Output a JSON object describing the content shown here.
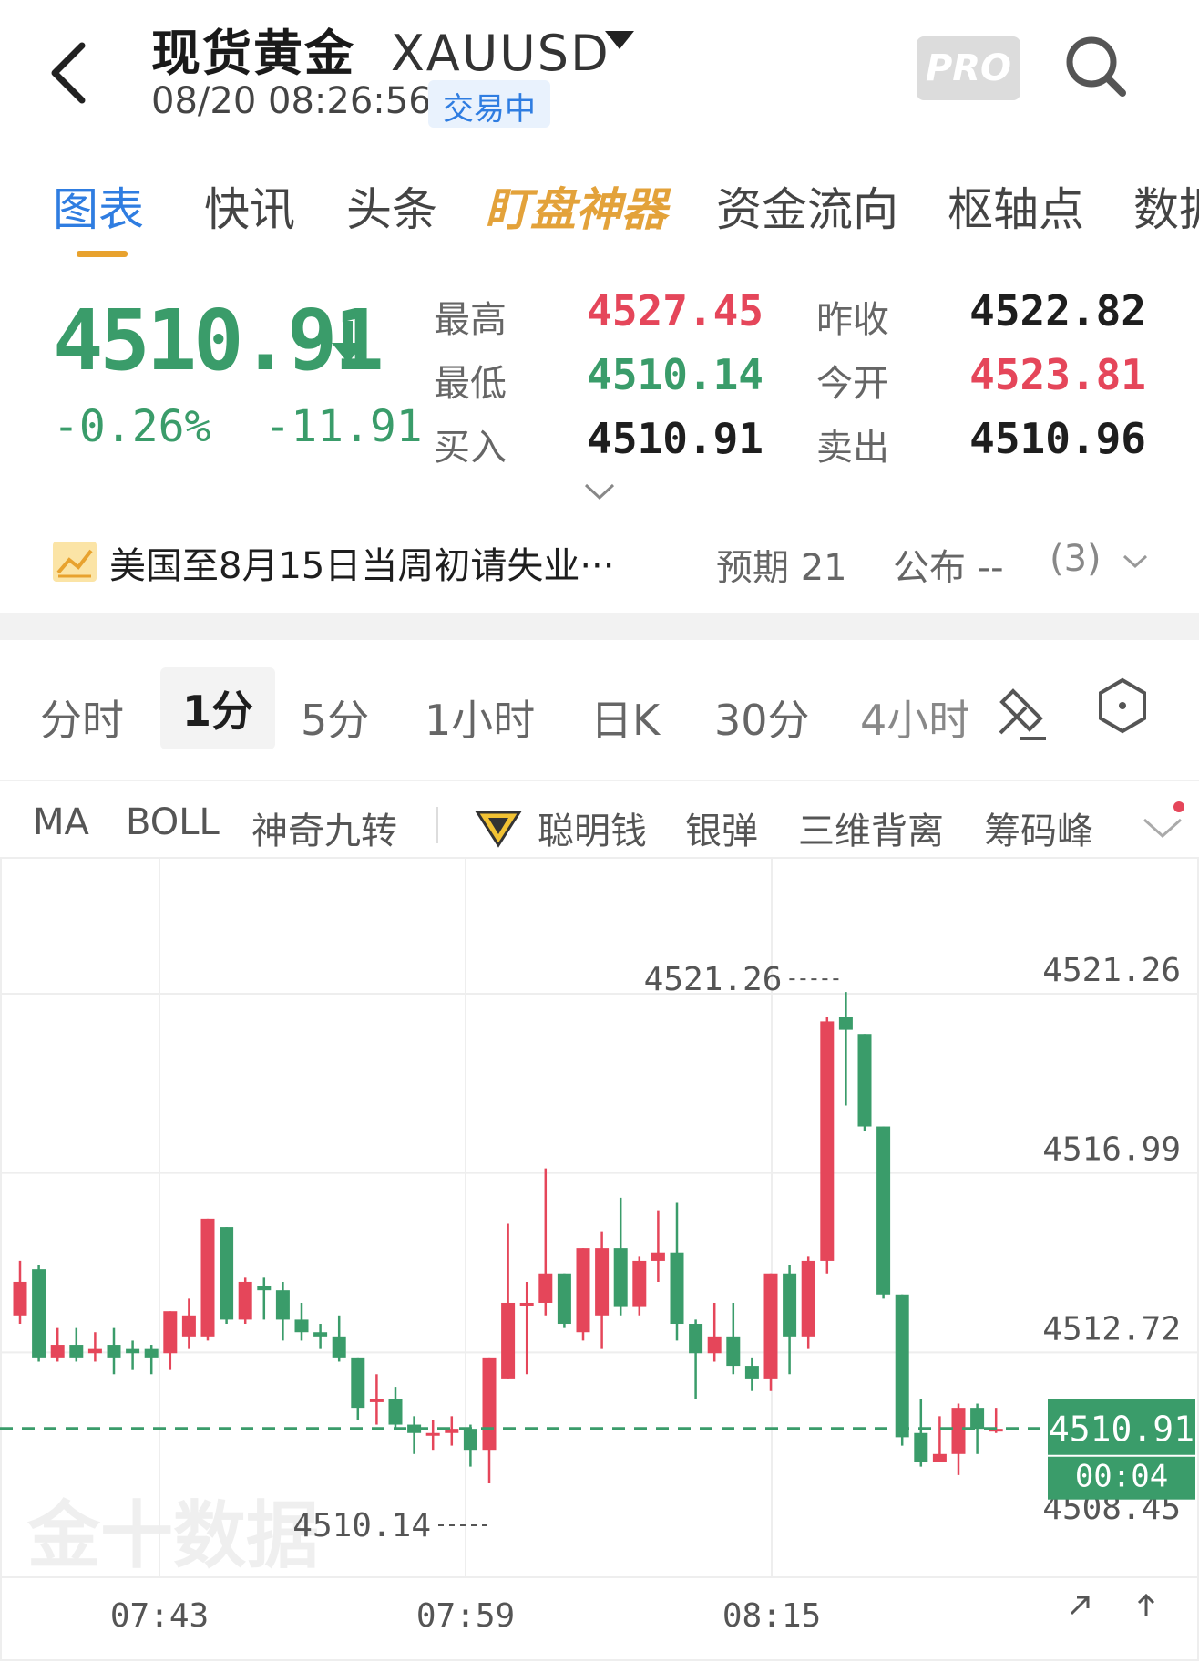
{
  "header": {
    "title": "现货黄金",
    "symbol": "XAUUSD",
    "datetime": "08/20 08:26:56",
    "status": "交易中",
    "pro_label": "PRO"
  },
  "tabs": [
    {
      "label": "图表",
      "active": true
    },
    {
      "label": "快讯"
    },
    {
      "label": "头条"
    },
    {
      "label": "盯盘神器",
      "special": true
    },
    {
      "label": "资金流向"
    },
    {
      "label": "枢轴点"
    },
    {
      "label": "数据"
    }
  ],
  "quote": {
    "price": "4510.91",
    "change_pct": "-0.26%",
    "change": "-11.91",
    "high_label": "最高",
    "high": "4527.45",
    "low_label": "最低",
    "low": "4510.14",
    "bid_label": "买入",
    "bid": "4510.91",
    "prev_close_label": "昨收",
    "prev_close": "4522.82",
    "open_label": "今开",
    "open": "4523.81",
    "ask_label": "卖出",
    "ask": "4510.96"
  },
  "news": {
    "title": "美国至8月15日当周初请失业···",
    "expected": "预期 21",
    "published": "公布 --",
    "count": "(3)"
  },
  "periods": [
    {
      "label": "分时"
    },
    {
      "label": "1分",
      "active": true
    },
    {
      "label": "5分"
    },
    {
      "label": "1小时"
    },
    {
      "label": "日K"
    },
    {
      "label": "30分"
    },
    {
      "label": "4小时"
    }
  ],
  "indicators": [
    "MA",
    "BOLL",
    "神奇九转",
    "聪明钱",
    "银弹",
    "三维背离",
    "筹码峰"
  ],
  "colors": {
    "up": "#e5465a",
    "down": "#3a9c6a",
    "accent": "#2f7de1"
  },
  "watermark": "金十数据",
  "chart_data": {
    "type": "candlestick",
    "y_ticks": [
      "4521.26",
      "4516.99",
      "4512.72",
      "4508.45"
    ],
    "x_ticks": [
      "07:43",
      "07:59",
      "08:15"
    ],
    "ylim": [
      4508.45,
      4521.26
    ],
    "max_label": "4521.26",
    "min_label": "4510.14",
    "last_price": "4510.91",
    "countdown": "00:04",
    "candles": [
      {
        "o": 4513.6,
        "c": 4514.4,
        "h": 4514.9,
        "l": 4513.4
      },
      {
        "o": 4514.7,
        "c": 4512.6,
        "h": 4514.8,
        "l": 4512.5
      },
      {
        "o": 4512.6,
        "c": 4512.9,
        "h": 4513.3,
        "l": 4512.5
      },
      {
        "o": 4512.9,
        "c": 4512.6,
        "h": 4513.3,
        "l": 4512.5
      },
      {
        "o": 4512.7,
        "c": 4512.8,
        "h": 4513.2,
        "l": 4512.5
      },
      {
        "o": 4512.9,
        "c": 4512.6,
        "h": 4513.3,
        "l": 4512.2
      },
      {
        "o": 4512.8,
        "c": 4512.7,
        "h": 4513.0,
        "l": 4512.3
      },
      {
        "o": 4512.8,
        "c": 4512.6,
        "h": 4512.9,
        "l": 4512.2
      },
      {
        "o": 4512.7,
        "c": 4513.7,
        "h": 4513.7,
        "l": 4512.3
      },
      {
        "o": 4513.1,
        "c": 4513.6,
        "h": 4514.0,
        "l": 4512.8
      },
      {
        "o": 4513.1,
        "c": 4515.9,
        "h": 4515.9,
        "l": 4513.0
      },
      {
        "o": 4515.7,
        "c": 4513.5,
        "h": 4515.7,
        "l": 4513.4
      },
      {
        "o": 4513.5,
        "c": 4514.4,
        "h": 4514.5,
        "l": 4513.4
      },
      {
        "o": 4514.3,
        "c": 4514.2,
        "h": 4514.5,
        "l": 4513.5
      },
      {
        "o": 4514.2,
        "c": 4513.5,
        "h": 4514.4,
        "l": 4513.0
      },
      {
        "o": 4513.5,
        "c": 4513.2,
        "h": 4513.9,
        "l": 4513.0
      },
      {
        "o": 4513.2,
        "c": 4513.1,
        "h": 4513.4,
        "l": 4512.8
      },
      {
        "o": 4513.1,
        "c": 4512.6,
        "h": 4513.6,
        "l": 4512.5
      },
      {
        "o": 4512.6,
        "c": 4511.4,
        "h": 4512.6,
        "l": 4511.1
      },
      {
        "o": 4511.6,
        "c": 4511.6,
        "h": 4512.2,
        "l": 4511.0
      },
      {
        "o": 4511.6,
        "c": 4511.0,
        "h": 4511.9,
        "l": 4510.9
      },
      {
        "o": 4511.0,
        "c": 4510.8,
        "h": 4511.2,
        "l": 4510.3
      },
      {
        "o": 4510.8,
        "c": 4510.8,
        "h": 4511.1,
        "l": 4510.4
      },
      {
        "o": 4510.8,
        "c": 4510.9,
        "h": 4511.2,
        "l": 4510.5
      },
      {
        "o": 4510.9,
        "c": 4510.4,
        "h": 4511.0,
        "l": 4510.0
      },
      {
        "o": 4510.4,
        "c": 4512.6,
        "h": 4512.6,
        "l": 4509.6
      },
      {
        "o": 4512.1,
        "c": 4513.9,
        "h": 4515.8,
        "l": 4512.1
      },
      {
        "o": 4513.9,
        "c": 4513.9,
        "h": 4514.4,
        "l": 4512.2
      },
      {
        "o": 4513.9,
        "c": 4514.6,
        "h": 4517.1,
        "l": 4513.6
      },
      {
        "o": 4514.6,
        "c": 4513.4,
        "h": 4514.6,
        "l": 4513.3
      },
      {
        "o": 4513.2,
        "c": 4515.2,
        "h": 4515.2,
        "l": 4513.0
      },
      {
        "o": 4513.6,
        "c": 4515.2,
        "h": 4515.6,
        "l": 4512.8
      },
      {
        "o": 4515.2,
        "c": 4513.8,
        "h": 4516.4,
        "l": 4513.6
      },
      {
        "o": 4513.8,
        "c": 4514.9,
        "h": 4515.0,
        "l": 4513.6
      },
      {
        "o": 4514.9,
        "c": 4515.1,
        "h": 4516.1,
        "l": 4514.4
      },
      {
        "o": 4515.1,
        "c": 4513.4,
        "h": 4516.3,
        "l": 4513.0
      },
      {
        "o": 4513.4,
        "c": 4512.7,
        "h": 4513.5,
        "l": 4511.6
      },
      {
        "o": 4512.7,
        "c": 4513.1,
        "h": 4513.9,
        "l": 4512.5
      },
      {
        "o": 4513.1,
        "c": 4512.4,
        "h": 4513.9,
        "l": 4512.2
      },
      {
        "o": 4512.4,
        "c": 4512.1,
        "h": 4512.6,
        "l": 4511.8
      },
      {
        "o": 4512.1,
        "c": 4514.6,
        "h": 4514.6,
        "l": 4511.8
      },
      {
        "o": 4514.6,
        "c": 4513.1,
        "h": 4514.8,
        "l": 4512.2
      },
      {
        "o": 4513.1,
        "c": 4514.9,
        "h": 4515.0,
        "l": 4512.8
      },
      {
        "o": 4514.9,
        "c": 4520.6,
        "h": 4520.7,
        "l": 4514.6
      },
      {
        "o": 4520.7,
        "c": 4520.4,
        "h": 4521.3,
        "l": 4518.6
      },
      {
        "o": 4520.3,
        "c": 4518.1,
        "h": 4520.3,
        "l": 4518.0
      },
      {
        "o": 4518.1,
        "c": 4514.1,
        "h": 4518.1,
        "l": 4514.0
      },
      {
        "o": 4514.1,
        "c": 4510.7,
        "h": 4514.1,
        "l": 4510.5
      },
      {
        "o": 4510.8,
        "c": 4510.1,
        "h": 4511.6,
        "l": 4510.0
      },
      {
        "o": 4510.1,
        "c": 4510.3,
        "h": 4511.2,
        "l": 4510.1
      },
      {
        "o": 4510.3,
        "c": 4511.4,
        "h": 4511.5,
        "l": 4509.8
      },
      {
        "o": 4511.4,
        "c": 4510.9,
        "h": 4511.5,
        "l": 4510.3
      },
      {
        "o": 4510.9,
        "c": 4510.9,
        "h": 4511.4,
        "l": 4510.8
      }
    ]
  }
}
